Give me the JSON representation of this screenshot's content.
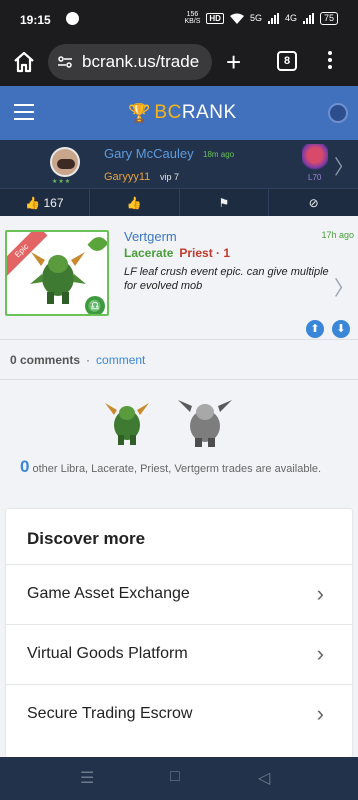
{
  "status_bar": {
    "time": "19:15",
    "net_speed_value": "156",
    "net_speed_unit": "KB/S",
    "hd": "HD",
    "signal_5g": "5G",
    "signal_4g": "4G",
    "battery": "75"
  },
  "browser": {
    "url": "bcrank.us/trade",
    "tab_count": "8"
  },
  "site": {
    "brand_prefix": "BC",
    "brand_suffix": "RANK"
  },
  "user": {
    "name": "Gary McCauley",
    "posted_ago": "18m ago",
    "game_name": "Garyyy11",
    "vip": "vip 7",
    "level": "L70",
    "stars": "★★★"
  },
  "actions": {
    "likes": "167"
  },
  "trade": {
    "badge": "Epic",
    "monster": "Vertgerm",
    "posted_ago": "17h ago",
    "race": "Lacerate",
    "class_level": "Priest · 1",
    "description": "LF leaf crush event epic. can give multiple for evolved mob",
    "comments_count": "0 comments",
    "comment_link": "comment"
  },
  "others": {
    "count": "0",
    "text": "other Libra, Lacerate, Priest, Vertgerm trades are available."
  },
  "discover": {
    "title": "Discover more",
    "items": [
      {
        "label": "Game Asset Exchange"
      },
      {
        "label": "Virtual Goods Platform"
      },
      {
        "label": "Secure Trading Escrow"
      }
    ]
  },
  "icons": {
    "home": "home-icon",
    "tune": "site-settings-icon",
    "plus": "plus-icon",
    "menu": "more-icon"
  },
  "colors": {
    "header_blue": "#4171bd",
    "epic_red": "#e36464",
    "green": "#6ac259",
    "link_blue": "#3a86d8",
    "orange": "#e68a2e"
  }
}
